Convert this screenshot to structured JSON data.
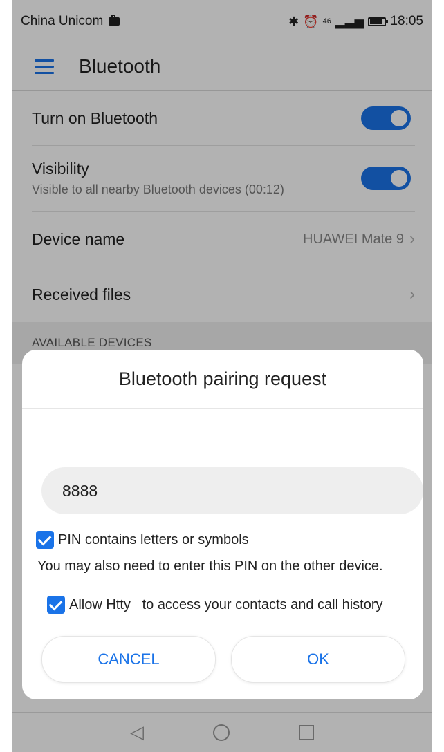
{
  "status_bar": {
    "carrier": "China Unicom",
    "signal_label": "46",
    "time": "18:05"
  },
  "app_bar": {
    "title": "Bluetooth"
  },
  "settings": {
    "turn_on_label": "Turn on Bluetooth",
    "turn_on_enabled": true,
    "visibility_label": "Visibility",
    "visibility_sub": "Visible to all nearby Bluetooth devices (00:12)",
    "visibility_enabled": true,
    "device_name_label": "Device name",
    "device_name_value": "HUAWEI Mate 9",
    "received_files_label": "Received files"
  },
  "section_header": "AVAILABLE DEVICES",
  "dialog": {
    "title": "Bluetooth pairing request",
    "pin_value": "8888",
    "pin_letters_label": "PIN contains letters or symbols",
    "pin_letters_checked": true,
    "note": "You may also need to enter this PIN on the other device.",
    "allow_label": "Allow Htty   to access your contacts and call history",
    "allow_checked": true,
    "cancel_label": "CANCEL",
    "ok_label": "OK"
  },
  "colors": {
    "accent": "#1a73e8"
  }
}
